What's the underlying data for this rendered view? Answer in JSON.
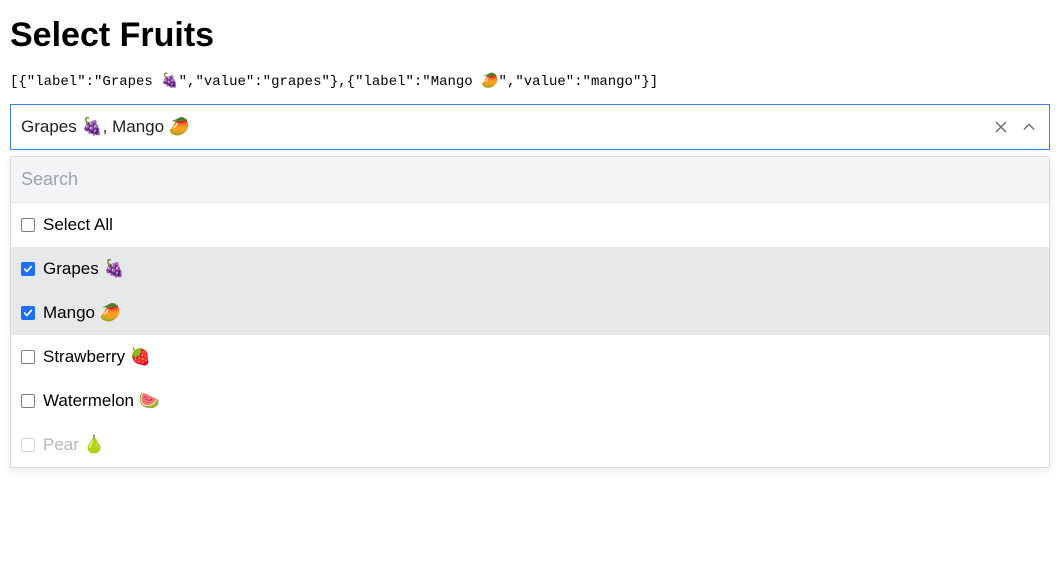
{
  "heading": "Select Fruits",
  "selected_json_preview": "[{\"label\":\"Grapes 🍇\",\"value\":\"grapes\"},{\"label\":\"Mango 🥭\",\"value\":\"mango\"}]",
  "multiselect": {
    "display_value": "Grapes 🍇, Mango 🥭",
    "search_placeholder": "Search",
    "select_all_label": "Select All",
    "options": [
      {
        "label": "Grapes 🍇",
        "value": "grapes",
        "checked": true,
        "disabled": false
      },
      {
        "label": "Mango 🥭",
        "value": "mango",
        "checked": true,
        "disabled": false
      },
      {
        "label": "Strawberry 🍓",
        "value": "strawberry",
        "checked": false,
        "disabled": false
      },
      {
        "label": "Watermelon 🍉",
        "value": "watermelon",
        "checked": false,
        "disabled": false
      },
      {
        "label": "Pear 🍐",
        "value": "pear",
        "checked": false,
        "disabled": true
      }
    ]
  },
  "colors": {
    "focus_border": "#3b82f6",
    "checkbox_checked": "#1d6ef8",
    "selected_row_bg": "#e7e8ea"
  }
}
